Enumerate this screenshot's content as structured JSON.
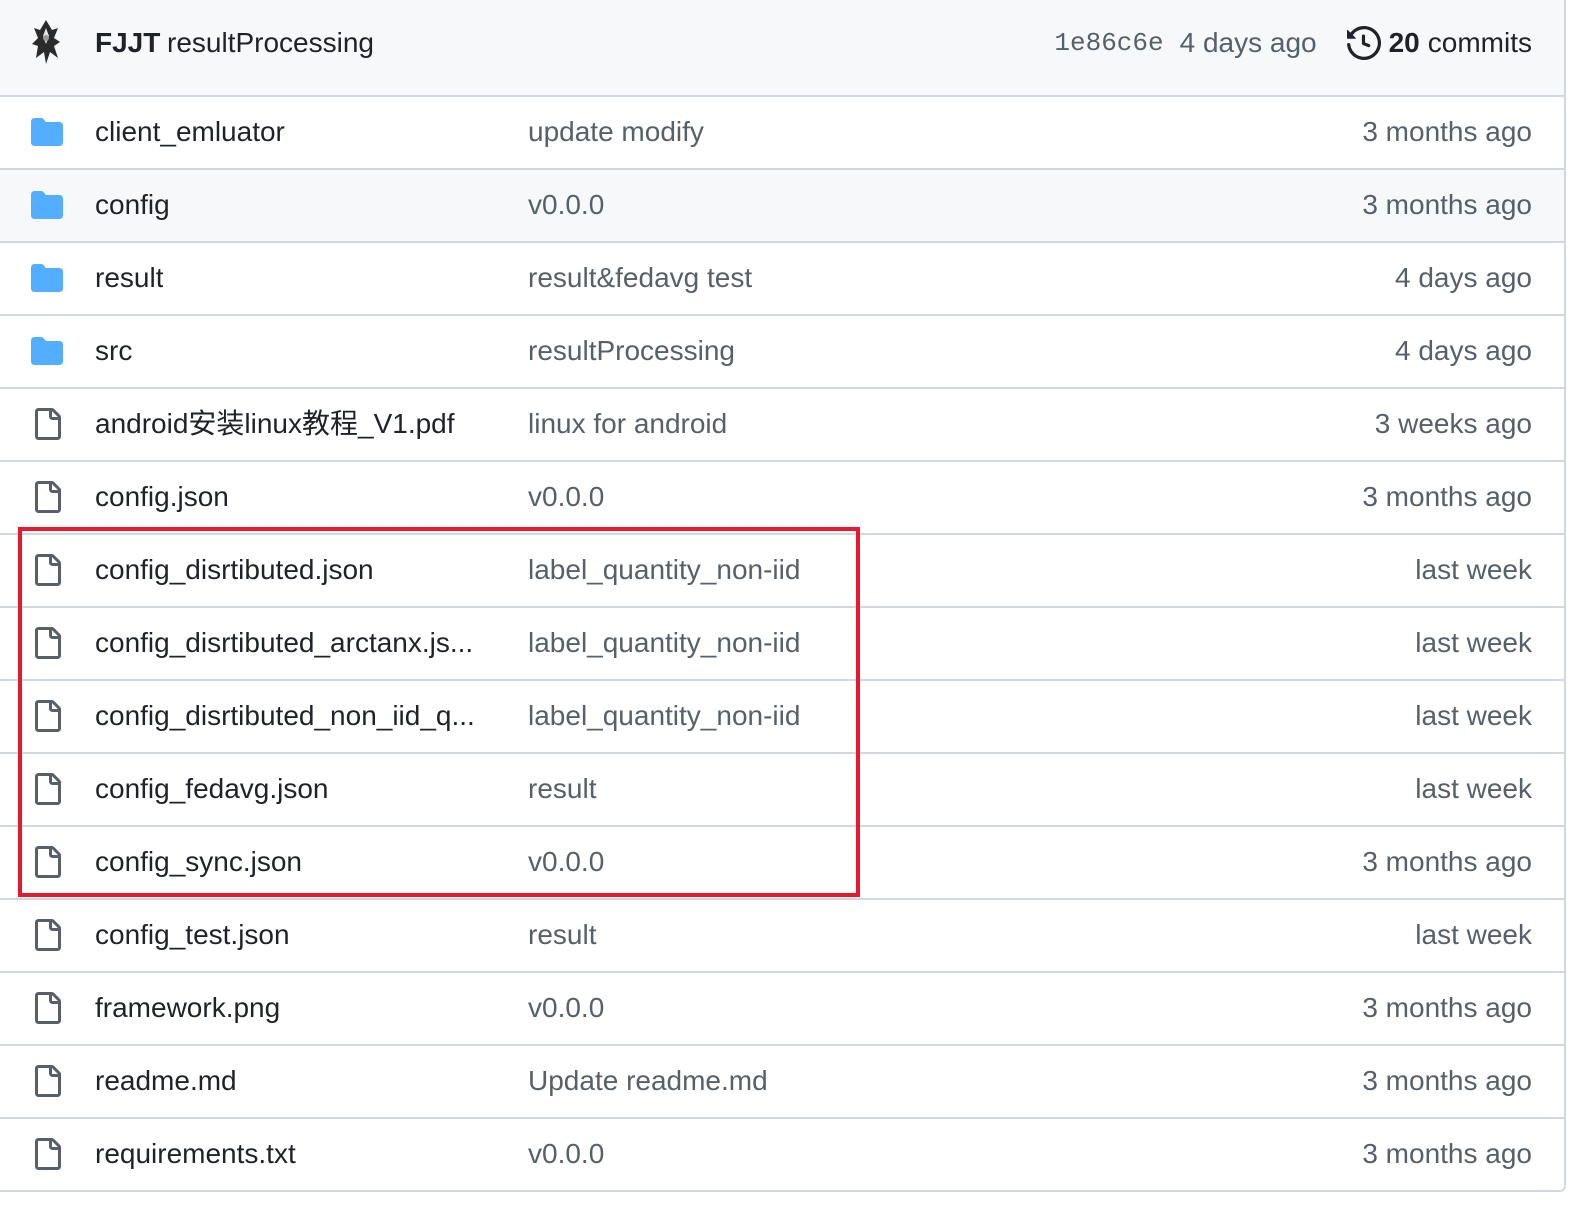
{
  "commit": {
    "author": "FJJT",
    "message": "resultProcessing",
    "sha": "1e86c6e",
    "age": "4 days ago",
    "commit_count": "20",
    "commits_label": "commits"
  },
  "files": [
    {
      "type": "folder",
      "name": "client_emluator",
      "message": "update modify",
      "age": "3 months ago"
    },
    {
      "type": "folder",
      "name": "config",
      "message": "v0.0.0",
      "age": "3 months ago"
    },
    {
      "type": "folder",
      "name": "result",
      "message": "result&fedavg test",
      "age": "4 days ago"
    },
    {
      "type": "folder",
      "name": "src",
      "message": "resultProcessing",
      "age": "4 days ago"
    },
    {
      "type": "file",
      "name": "android安装linux教程_V1.pdf",
      "message": "linux for android",
      "age": "3 weeks ago"
    },
    {
      "type": "file",
      "name": "config.json",
      "message": "v0.0.0",
      "age": "3 months ago"
    },
    {
      "type": "file",
      "name": "config_disrtibuted.json",
      "message": "label_quantity_non-iid",
      "age": "last week"
    },
    {
      "type": "file",
      "name": "config_disrtibuted_arctanx.js...",
      "message": "label_quantity_non-iid",
      "age": "last week"
    },
    {
      "type": "file",
      "name": "config_disrtibuted_non_iid_q...",
      "message": "label_quantity_non-iid",
      "age": "last week"
    },
    {
      "type": "file",
      "name": "config_fedavg.json",
      "message": "result",
      "age": "last week"
    },
    {
      "type": "file",
      "name": "config_sync.json",
      "message": "v0.0.0",
      "age": "3 months ago"
    },
    {
      "type": "file",
      "name": "config_test.json",
      "message": "result",
      "age": "last week"
    },
    {
      "type": "file",
      "name": "framework.png",
      "message": "v0.0.0",
      "age": "3 months ago"
    },
    {
      "type": "file",
      "name": "readme.md",
      "message": "Update readme.md",
      "age": "3 months ago"
    },
    {
      "type": "file",
      "name": "requirements.txt",
      "message": "v0.0.0",
      "age": "3 months ago"
    }
  ],
  "colors": {
    "folder": "#54aeff",
    "highlight": "#e8192c"
  }
}
